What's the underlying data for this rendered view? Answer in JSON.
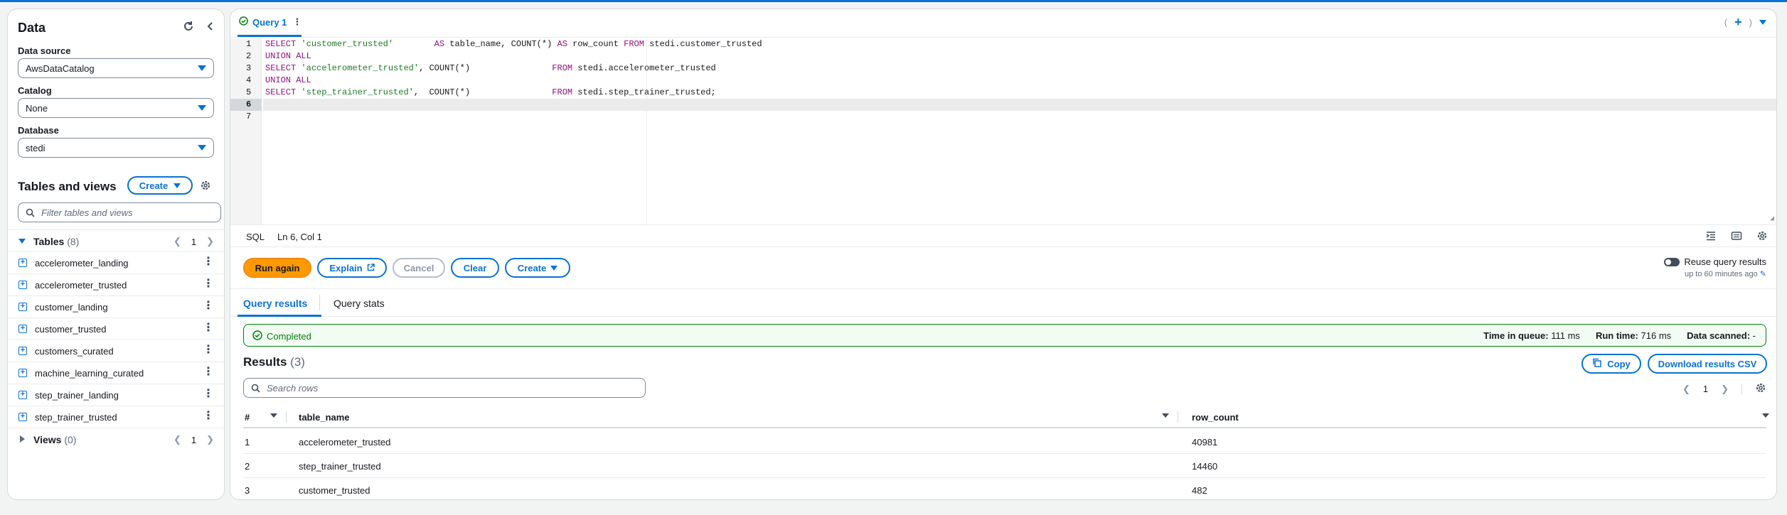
{
  "left": {
    "title": "Data",
    "data_source": {
      "label": "Data source",
      "value": "AwsDataCatalog"
    },
    "catalog": {
      "label": "Catalog",
      "value": "None"
    },
    "database": {
      "label": "Database",
      "value": "stedi"
    },
    "tables_and_views": {
      "title": "Tables and views",
      "create_label": "Create"
    },
    "filter_placeholder": "Filter tables and views",
    "tables": {
      "label": "Tables",
      "count": "(8)",
      "page": "1",
      "items": [
        "accelerometer_landing",
        "accelerometer_trusted",
        "customer_landing",
        "customer_trusted",
        "customers_curated",
        "machine_learning_curated",
        "step_trainer_landing",
        "step_trainer_trusted"
      ]
    },
    "views": {
      "label": "Views",
      "count": "(0)",
      "page": "1"
    }
  },
  "editor": {
    "tab_label": "Query 1",
    "line_numbers": [
      "1",
      "2",
      "3",
      "4",
      "5",
      "6",
      "7"
    ],
    "active_line": 6,
    "status_lang": "SQL",
    "status_pos": "Ln 6, Col 1"
  },
  "actions": {
    "run_again": "Run again",
    "explain": "Explain",
    "cancel": "Cancel",
    "clear": "Clear",
    "create": "Create",
    "reuse_label": "Reuse query results",
    "reuse_sub": "up to 60 minutes ago"
  },
  "results_tabs": {
    "results": "Query results",
    "stats": "Query stats"
  },
  "status": {
    "text": "Completed",
    "queue_label": "Time in queue:",
    "queue_value": "111 ms",
    "run_label": "Run time:",
    "run_value": "716 ms",
    "scanned_label": "Data scanned:",
    "scanned_value": "-"
  },
  "results": {
    "title": "Results",
    "count": "(3)",
    "copy_label": "Copy",
    "download_label": "Download results CSV",
    "search_placeholder": "Search rows",
    "page": "1",
    "columns": [
      "#",
      "table_name",
      "row_count"
    ],
    "rows": [
      {
        "n": "1",
        "table_name": "accelerometer_trusted",
        "row_count": "40981"
      },
      {
        "n": "2",
        "table_name": "step_trainer_trusted",
        "row_count": "14460"
      },
      {
        "n": "3",
        "table_name": "customer_trusted",
        "row_count": "482"
      }
    ]
  },
  "colors": {
    "accent": "#0972d3",
    "primary": "#ff9900",
    "success": "#037f0c"
  }
}
